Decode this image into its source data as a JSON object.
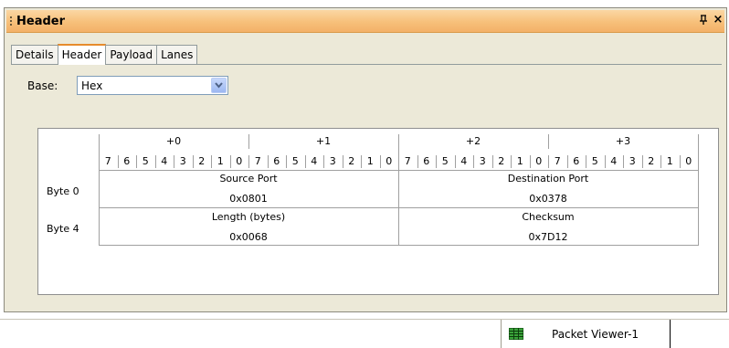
{
  "panel": {
    "title": "Header",
    "pin_glyph": "ᵖ",
    "close_glyph": "×"
  },
  "tabs": [
    {
      "label": "Details",
      "active": false
    },
    {
      "label": "Header",
      "active": true
    },
    {
      "label": "Payload",
      "active": false
    },
    {
      "label": "Lanes",
      "active": false
    }
  ],
  "base": {
    "label": "Base:",
    "selected": "Hex"
  },
  "grid": {
    "offsets": [
      "+0",
      "+1",
      "+2",
      "+3"
    ],
    "bits": [
      "7",
      "6",
      "5",
      "4",
      "3",
      "2",
      "1",
      "0"
    ],
    "rows": [
      {
        "label": "Byte 0",
        "fields": [
          {
            "name": "Source Port",
            "value": "0x0801"
          },
          {
            "name": "Destination Port",
            "value": "0x0378"
          }
        ]
      },
      {
        "label": "Byte 4",
        "fields": [
          {
            "name": "Length (bytes)",
            "value": "0x0068"
          },
          {
            "name": "Checksum",
            "value": "0x7D12"
          }
        ]
      }
    ]
  },
  "doc_tab": {
    "label": "Packet Viewer-1",
    "icon": "grid-table-icon"
  },
  "colors": {
    "title_gradient_top": "#fbd7a4",
    "title_gradient_bottom": "#f3b168",
    "active_tab_accent": "#e68b2c",
    "panel_bg": "#ece9d8"
  }
}
